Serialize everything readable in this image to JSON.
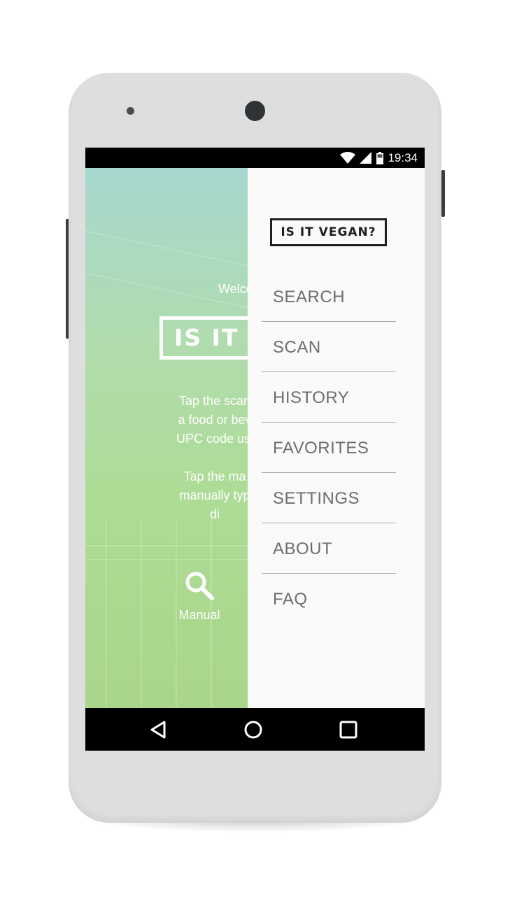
{
  "status_bar": {
    "time": "19:34",
    "icons": [
      "wifi-icon",
      "cell-signal-icon",
      "battery-icon"
    ]
  },
  "background_screen": {
    "welcome_text": "Welco",
    "logo_text": "IS IT VE",
    "instruction_1": "Tap the scan\na food or bev\nUPC code usi",
    "instruction_2": "Tap the ma\nmanually typ\ndi",
    "manual_label": "Manual",
    "manual_icon": "search-icon"
  },
  "drawer": {
    "logo_text": "IS IT VEGAN?",
    "items": [
      {
        "label": "SEARCH"
      },
      {
        "label": "SCAN"
      },
      {
        "label": "HISTORY"
      },
      {
        "label": "FAVORITES"
      },
      {
        "label": "SETTINGS"
      },
      {
        "label": "ABOUT"
      },
      {
        "label": "FAQ"
      }
    ]
  },
  "nav_bar": {
    "buttons": [
      "back-icon",
      "home-icon",
      "recents-icon"
    ]
  },
  "colors": {
    "drawer_bg": "#fafaf8",
    "menu_text": "#6d6d6d",
    "divider": "#a8a8a8",
    "bg_green": "#addc96",
    "bg_teal": "#a6d8cf",
    "device_body": "#dedede"
  }
}
